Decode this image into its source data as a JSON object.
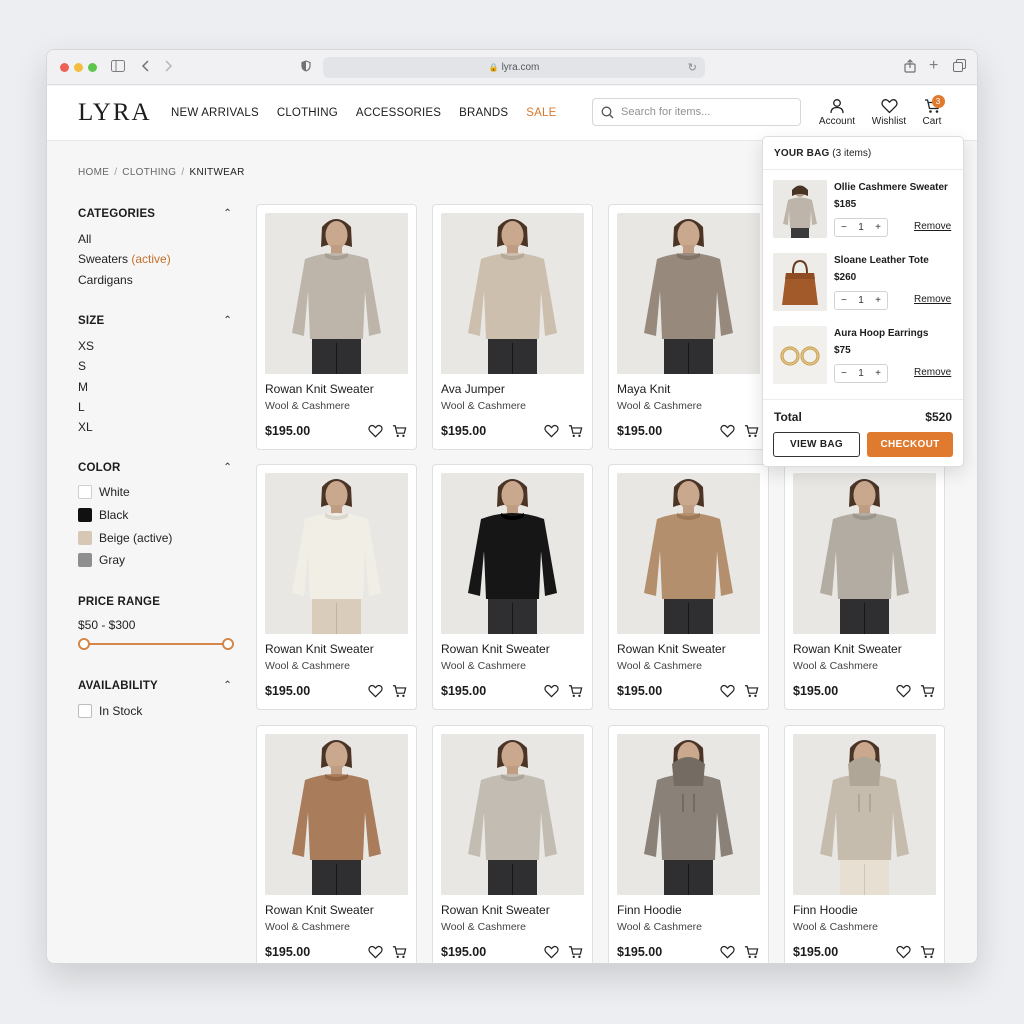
{
  "browser": {
    "url": "lyra.com"
  },
  "site": {
    "logo": "LYRA",
    "nav": [
      "NEW ARRIVALS",
      "CLOTHING",
      "ACCESSORIES",
      "BRANDS",
      "SALE"
    ],
    "search_placeholder": "Search for items...",
    "account_label": "Account",
    "wishlist_label": "Wishlist",
    "cart_label": "Cart",
    "cart_count": "3"
  },
  "breadcrumb": [
    "HOME",
    "CLOTHING",
    "KNITWEAR"
  ],
  "filters": {
    "categories": {
      "title": "CATEGORIES",
      "items": [
        "All",
        "Sweaters",
        "Cardigans"
      ],
      "active_suffix": "(active)"
    },
    "size": {
      "title": "SIZE",
      "items": [
        "XS",
        "S",
        "M",
        "L",
        "XL"
      ]
    },
    "color": {
      "title": "COLOR",
      "items": [
        {
          "label": "White",
          "hex": "#ffffff"
        },
        {
          "label": "Black",
          "hex": "#111111"
        },
        {
          "label": "Beige (active)",
          "hex": "#d7c8b6"
        },
        {
          "label": "Gray",
          "hex": "#8f8f90"
        }
      ]
    },
    "price": {
      "title": "PRICE RANGE",
      "range": "$50 - $300"
    },
    "availability": {
      "title": "AVAILABILITY",
      "items": [
        "In Stock"
      ]
    }
  },
  "products": [
    {
      "name": "Rowan Knit Sweater",
      "material": "Wool & Cashmere",
      "price": "$195.00",
      "color": "#bdb5aa"
    },
    {
      "name": "Ava Jumper",
      "material": "Wool & Cashmere",
      "price": "$195.00",
      "color": "#cdbfae"
    },
    {
      "name": "Maya Knit",
      "material": "Wool & Cashmere",
      "price": "$195.00",
      "color": "#978a7d"
    },
    {
      "name": "Rowan Knit Sweater",
      "material": "Wool & Cashmere",
      "price": "$195.00",
      "color": "#f1eee6"
    },
    {
      "name": "Rowan Knit Sweater",
      "material": "Wool & Cashmere",
      "price": "$195.00",
      "color": "#161616"
    },
    {
      "name": "Rowan Knit Sweater",
      "material": "Wool & Cashmere",
      "price": "$195.00",
      "color": "#b38f6e"
    },
    {
      "name": "Rowan Knit Sweater",
      "material": "Wool & Cashmere",
      "price": "$195.00",
      "color": "#b2aca3"
    },
    {
      "name": "Rowan Knit Sweater",
      "material": "Wool & Cashmere",
      "price": "$195.00",
      "color": "#a97c5c"
    },
    {
      "name": "Rowan Knit Sweater",
      "material": "Wool & Cashmere",
      "price": "$195.00",
      "color": "#c2bcb2"
    },
    {
      "name": "Finn Hoodie",
      "material": "Wool & Cashmere",
      "price": "$195.00",
      "color": "#8a8178"
    },
    {
      "name": "Finn Hoodie",
      "material": "Wool & Cashmere",
      "price": "$195.00",
      "color": "#c6bcae"
    }
  ],
  "bag": {
    "title": "YOUR BAG",
    "count": "(3 items)",
    "items": [
      {
        "name": "Ollie Cashmere Sweater",
        "price": "$185",
        "qty": "1",
        "remove": "Remove"
      },
      {
        "name": "Sloane Leather Tote",
        "price": "$260",
        "qty": "1",
        "remove": "Remove"
      },
      {
        "name": "Aura Hoop Earrings",
        "price": "$75",
        "qty": "1",
        "remove": "Remove"
      }
    ],
    "total_label": "Total",
    "total_value": "$520",
    "view_bag": "VIEW BAG",
    "checkout": "CHECKOUT"
  },
  "colors": {
    "accent": "#e07a2e",
    "active_text": "#c46f2a"
  }
}
